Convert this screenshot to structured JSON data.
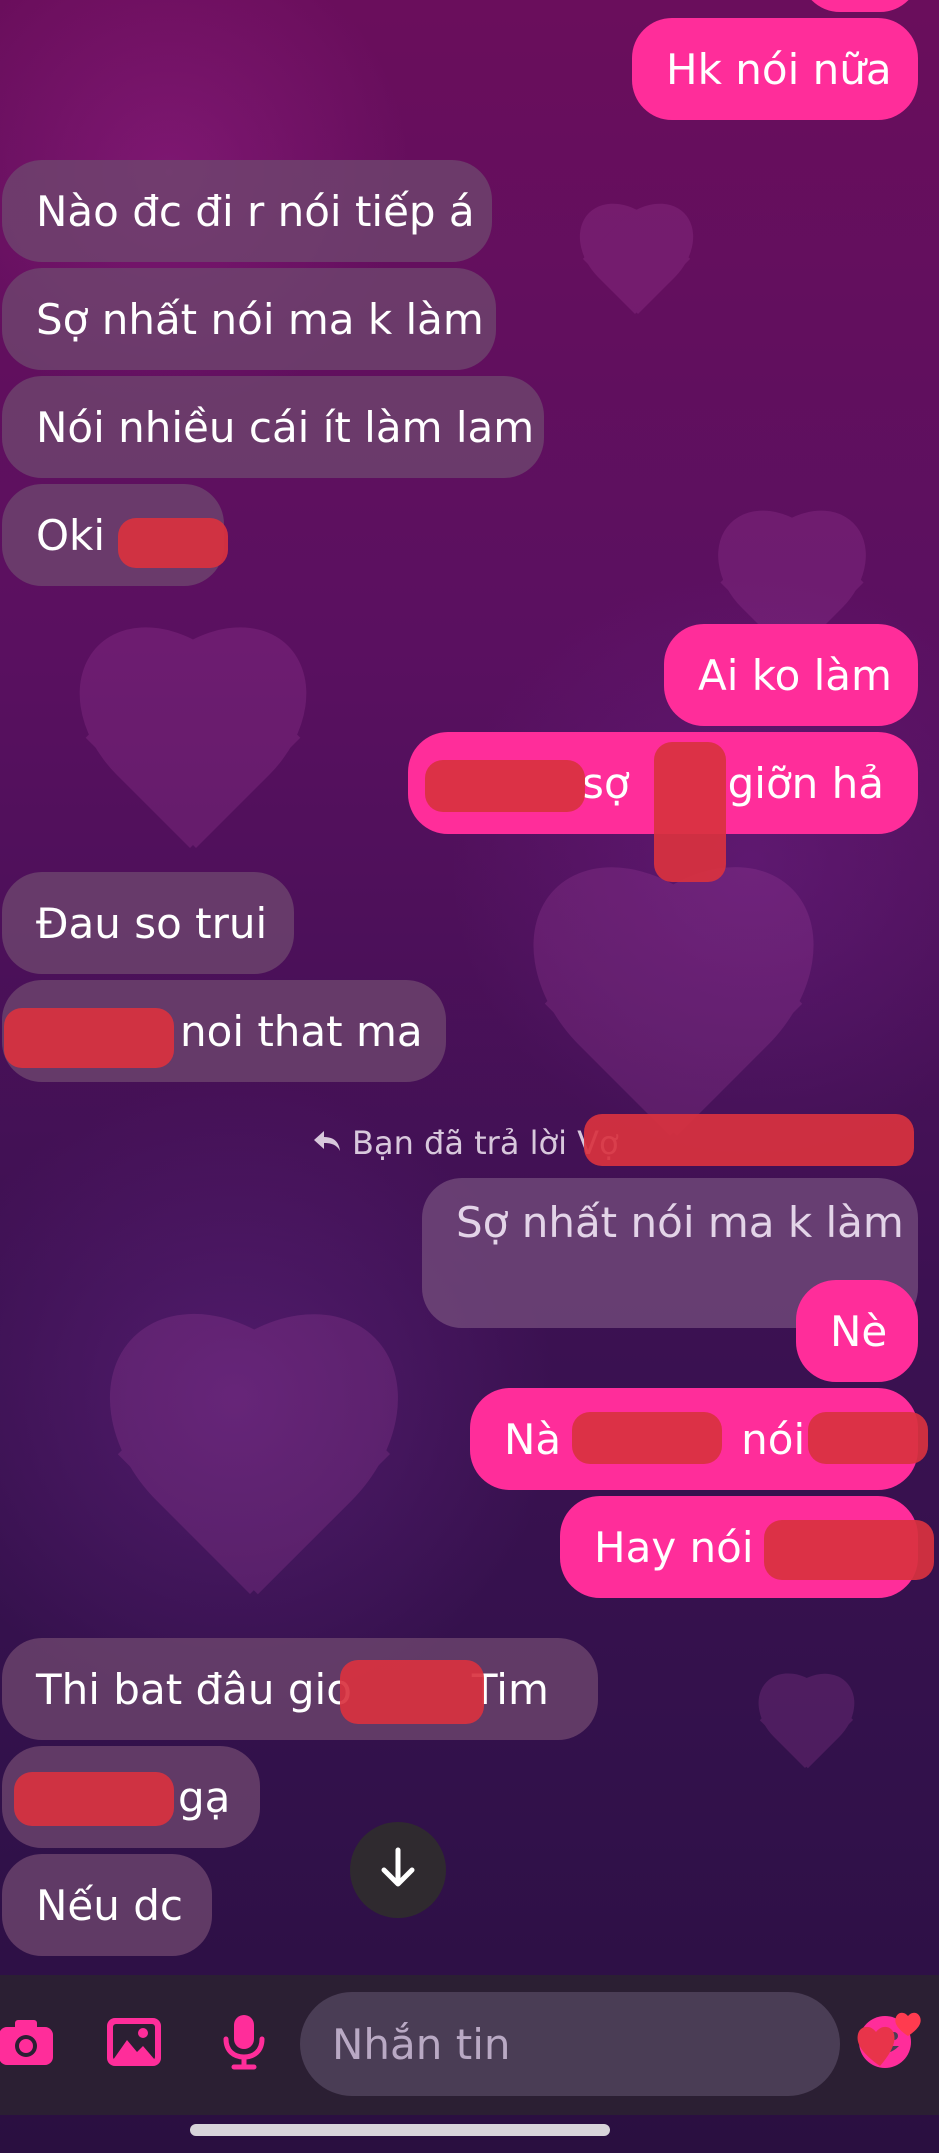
{
  "conversation": {
    "messages": [
      {
        "id": "m1",
        "side": "out",
        "text": "Hk nói nữa"
      },
      {
        "id": "m2",
        "side": "in",
        "text": "Nào đc đi r nói tiếp á"
      },
      {
        "id": "m3",
        "side": "in",
        "text": "Sợ nhất nói ma k làm"
      },
      {
        "id": "m4",
        "side": "in",
        "text": "Nói nhiều cái ít làm lam"
      },
      {
        "id": "m5",
        "side": "in",
        "text": "Oki"
      },
      {
        "id": "m6",
        "side": "out",
        "text": "Ai ko làm"
      },
      {
        "id": "m7",
        "side": "out",
        "text": "sợ",
        "text2": "giỡn hả"
      },
      {
        "id": "m8",
        "side": "in",
        "text": "Đau so trui"
      },
      {
        "id": "m9",
        "side": "in",
        "text": "noi that ma"
      },
      {
        "id": "m10",
        "side": "out",
        "text": "Nè"
      },
      {
        "id": "m11",
        "side": "out",
        "text": "Nà",
        "text2": "nói"
      },
      {
        "id": "m12",
        "side": "out",
        "text": "Hay nói"
      },
      {
        "id": "m13",
        "side": "in",
        "text": "Thi bat đâu gio",
        "text2": "Tim"
      },
      {
        "id": "m14",
        "side": "in",
        "text": "gạ"
      },
      {
        "id": "m15",
        "side": "in",
        "text": "Nếu dc"
      }
    ],
    "reply_note": "Bạn đã trả lời Vợ",
    "reply_quote": "Sợ nhất nói ma k làm"
  },
  "composer": {
    "placeholder": "Nhắn tin",
    "icons": [
      "camera-icon",
      "image-icon",
      "mic-icon",
      "emoji-icon",
      "hearts-icon"
    ]
  },
  "colors": {
    "outgoing_bubble": "#ff2d9a",
    "incoming_bubble": "#6e466e",
    "accent": "#ff2d9a"
  }
}
